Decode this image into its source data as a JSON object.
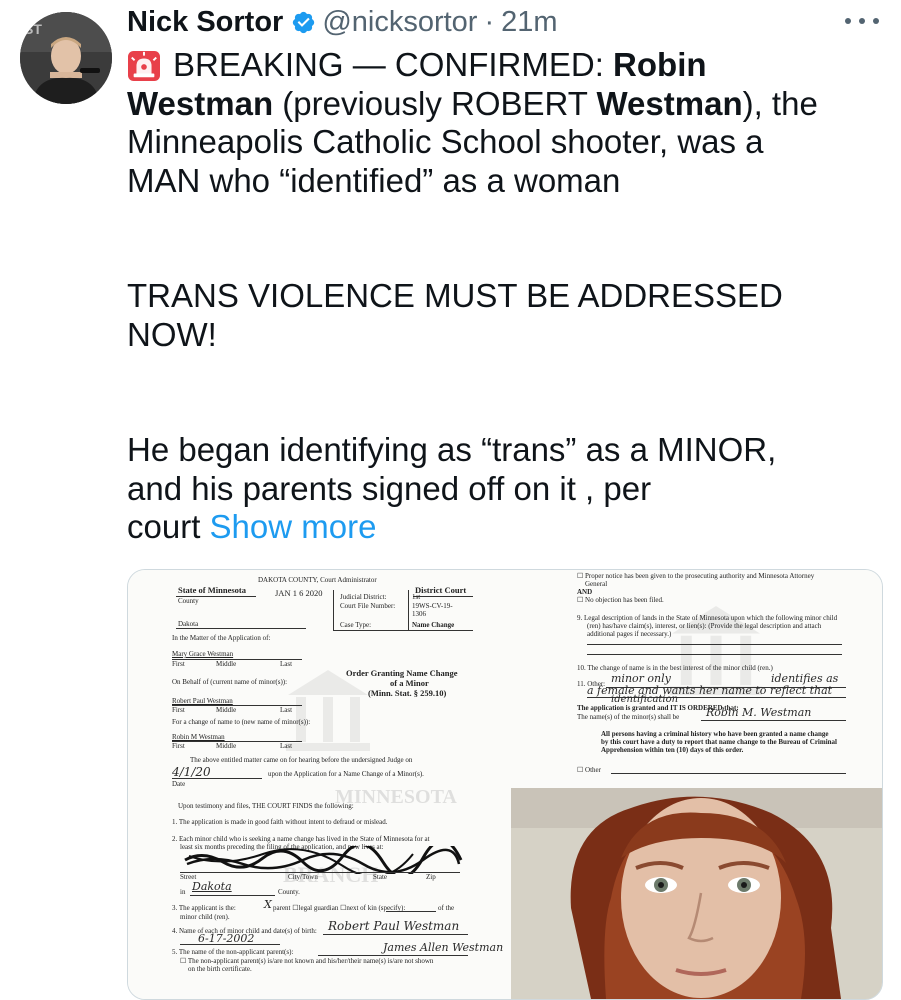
{
  "tweet": {
    "author_name": "Nick Sortor",
    "handle": "@nicksortor",
    "separator": "·",
    "time": "21m",
    "line1_prefix": "BREAKING — CONFIRMED: ",
    "line1_bold": "Robin",
    "line2_bold1": "Westman",
    "line2_mid": " (previously ROBERT ",
    "line2_bold2": "Westman",
    "line2_suffix": "), the",
    "line3": "Minneapolis Catholic School shooter, was a",
    "line4": "MAN who “identified” as a woman",
    "para2_line1": "TRANS VIOLENCE MUST BE ADDRESSED",
    "para2_line2": "NOW!",
    "para3_line1": "He began identifying as “trans” as a MINOR,",
    "para3_line2": "and his parents signed off on it , per",
    "para3_line3": "court ",
    "show_more": "Show more"
  },
  "icons": {
    "verified": "verified-badge-icon",
    "siren": "rotating-light-emoji",
    "more": "more-horizontal-icon"
  },
  "colors": {
    "link": "#1d9bf0",
    "verified": "#1d9bf0",
    "secondary_text": "#536471"
  },
  "document_left": {
    "stamp_header": "DAKOTA COUNTY, Court Administrator",
    "state": "State of Minnesota",
    "county_label": "County",
    "county_value": "Dakota",
    "filed_date": "JAN 1 6 2020",
    "court": "District Court",
    "judicial_district_label": "Judicial District:",
    "judicial_district_value": "1st",
    "file_number_label": "Court File Number:",
    "file_number_value": "19WS-CV-19-1306",
    "case_type_label": "Case Type:",
    "case_type_value": "Name Change",
    "matter_line": "In the Matter of the Application of:",
    "applicant_name": "Mary Grace Westman",
    "first": "First",
    "middle": "Middle",
    "last": "Last",
    "order_title_1": "Order Granting Name Change",
    "order_title_2": "of a Minor",
    "order_title_3": "(Minn. Stat. § 259.10)",
    "behalf_line": "On Behalf of (current name of minor(s)):",
    "minor_name": "Robert Paul Westman",
    "change_line": "For a change of name to (new name of minor(s)):",
    "new_name": "Robin M Westman",
    "hearing_text_1": "The above entitled matter came on for hearing before the undersigned Judge on",
    "hearing_date": "4/1/20",
    "hearing_text_2": "upon the Application for a Name Change of a Minor(s).",
    "date_label": "Date",
    "finds_line": "Upon testimony and files, THE COURT FINDS the following:",
    "item1": "1.  The application is made in good faith without intent to defraud or mislead.",
    "item2a": "2.  Each minor child who is seeking a name change has lived in the State of Minnesota for at",
    "item2b": "least six months preceding the filing of the application, and now lives at:",
    "street_label": "Street",
    "city_label": "City/Town",
    "state_label": "State",
    "zip_label": "Zip",
    "in_label": "in",
    "county_hw": "Dakota",
    "county_word": "County.",
    "item3a": "3.  The applicant is the:",
    "item3b": "parent   ☐legal guardian  ☐next of kin (specify):",
    "item3c": "of the",
    "item3d": "minor child (ren).",
    "item4": "4.  Name of each of minor child and date(s) of birth:",
    "item4_hw": "Robert Paul Westman",
    "item4_dob": "6-17-2002",
    "item5": "5.  The name of the non-applicant parent(s):",
    "item5_hw": "James Allen Westman",
    "item5b": "☐ The non-applicant parent(s) is/are not known and his/her/their name(s) is/are not shown",
    "item5c": "on the birth certificate."
  },
  "document_right": {
    "notice_1": "☐ Proper notice has been given to the prosecuting authority and Minnesota Attorney",
    "notice_2": "General",
    "and": "AND",
    "no_objection": "☐ No objection has been filed.",
    "item9a": "9.  Legal description of lands in the State of Minnesota upon which the following minor child",
    "item9b": "(ren) has/have claim(s), interest, or lien(s): (Provide the legal description and attach",
    "item9c": "additional pages if necessary.)",
    "item10": "10.  The change of name is in the best interest of the minor child (ren.)",
    "item11": "11.  Other:",
    "item11_hw1": "minor only",
    "item11_hw2": "identifies as",
    "item11_hw3": "a female and wants her name to reflect that",
    "item11_hw4": "identification",
    "ordered": "The application is granted and IT IS ORDERED that:",
    "new_name_line": "The name(s) of the minor(s) shall be",
    "new_name_hw": "Robin M. Westman",
    "criminal_1": "All persons having a criminal history who have been granted a name change",
    "criminal_2": "by this court have a duty to report that name change to the Bureau of Criminal",
    "criminal_3": "Apprehension within ten (10) days of this order.",
    "other": "☐ Other"
  },
  "seal_text": [
    "MINNESOTA",
    "BRANCH"
  ]
}
